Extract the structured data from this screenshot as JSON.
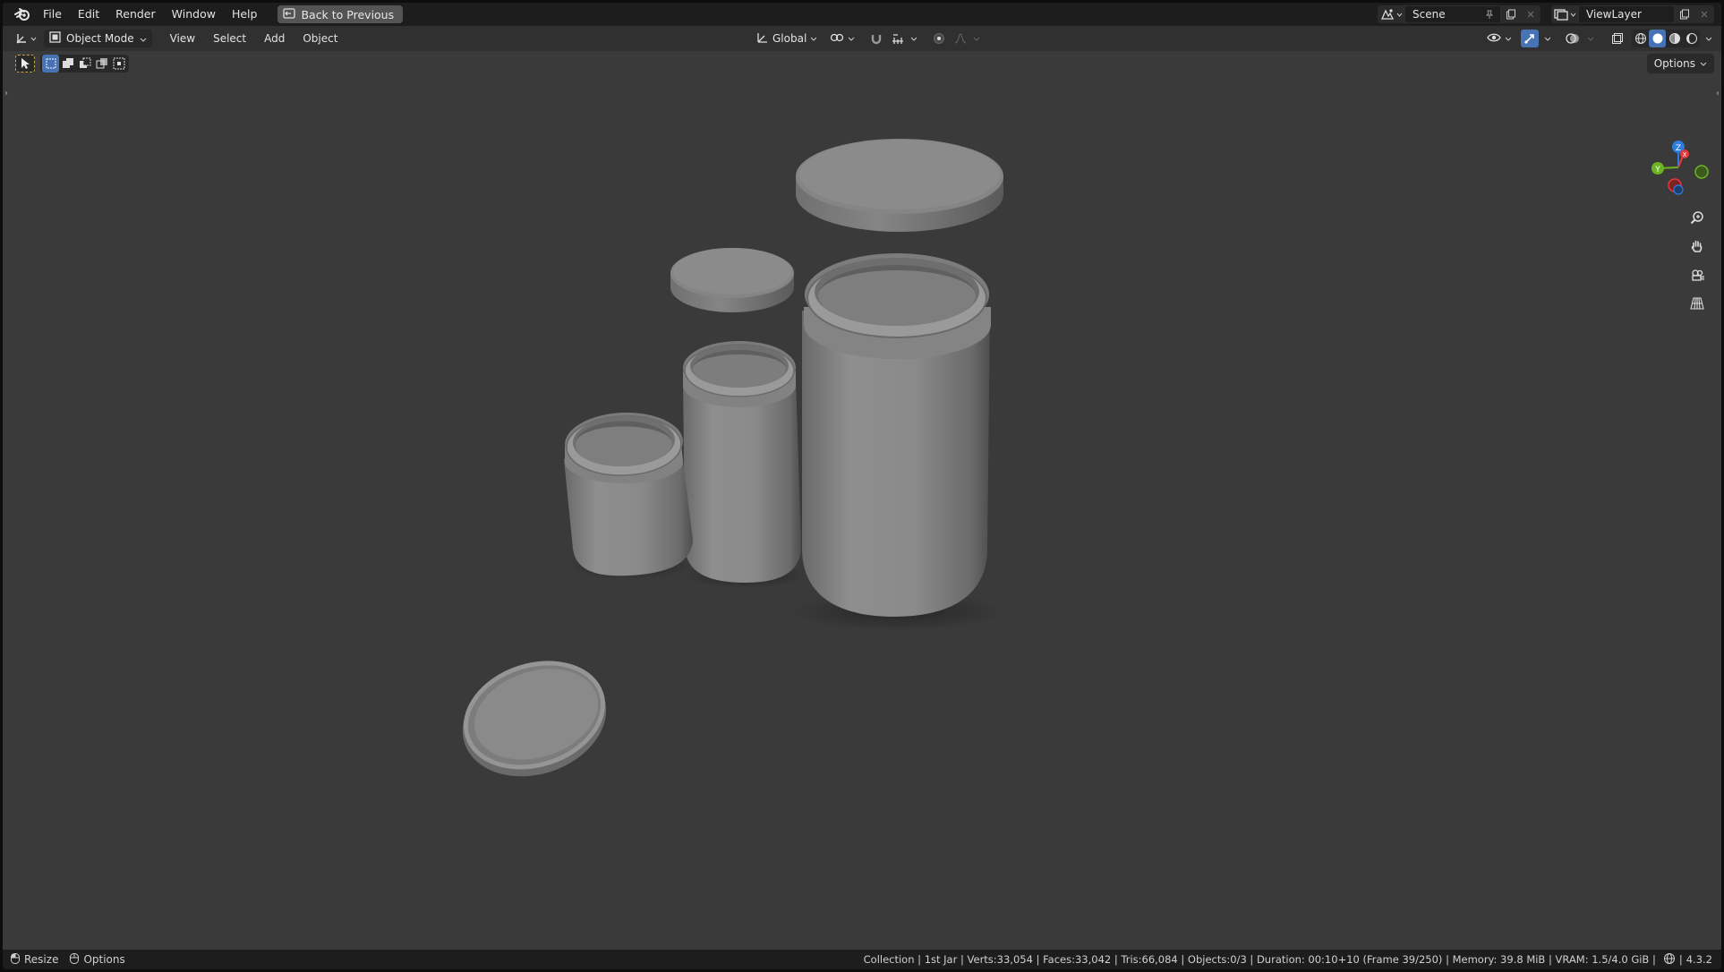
{
  "menubar": {
    "items": [
      "File",
      "Edit",
      "Render",
      "Window",
      "Help"
    ],
    "back_button": "Back to Previous"
  },
  "scene": {
    "name": "Scene"
  },
  "view_layer": {
    "name": "ViewLayer"
  },
  "header": {
    "mode": "Object Mode",
    "menus": [
      "View",
      "Select",
      "Add",
      "Object"
    ],
    "transform_orientation": "Global"
  },
  "tool_header": {
    "options_label": "Options"
  },
  "statusbar": {
    "left": {
      "resize": "Resize",
      "options": "Options"
    },
    "info": "Collection | 1st Jar | Verts:33,054 | Faces:33,042 | Tris:66,084 | Objects:0/3 | Duration: 00:10+10 (Frame 39/250) | Memory: 39.8 MiB | VRAM: 1.5/4.0 GiB |",
    "version": "4.3.2"
  },
  "gizmo": {
    "x_label": "X",
    "y_label": "Y",
    "z_label": "Z"
  },
  "colors": {
    "viewport_bg": "#3a3a3a",
    "active_blue": "#4772b3",
    "axis_x": "#e8383a",
    "axis_y": "#6db324",
    "axis_z": "#2d7ce0"
  },
  "scene_objects": [
    "large-jar",
    "large-jar-lid",
    "medium-jar",
    "medium-jar-lid",
    "small-jar",
    "small-jar-lid"
  ]
}
